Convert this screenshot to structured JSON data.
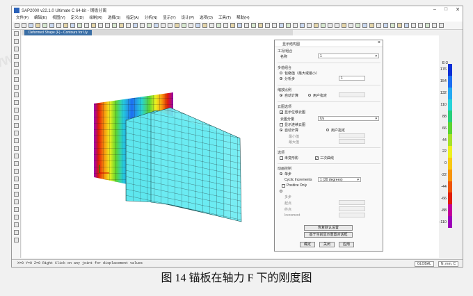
{
  "window": {
    "title": "SAP2000 v22.1.0 Ultimate C 64-bit - 钢板分离",
    "controls": [
      "–",
      "□",
      "✕"
    ]
  },
  "menu": [
    "文件(F)",
    "编辑(E)",
    "视图(V)",
    "定义(D)",
    "绘制(R)",
    "选择(S)",
    "指定(A)",
    "分析(N)",
    "显示(Y)",
    "设计(P)",
    "选项(O)",
    "工具(T)",
    "帮助(H)"
  ],
  "view_tab": "Deformed Shape (F) - Contours for Uy",
  "status": {
    "text": "X=0 Y=0 Z=0  Right Click on any joint for displacement values",
    "coord": "GLOBAL",
    "units": "N, mm, C"
  },
  "legend": {
    "header": "E-3",
    "labels": [
      "176",
      "154",
      "132",
      "110",
      "88",
      "66",
      "44",
      "22",
      "0",
      "-22",
      "-44",
      "-66",
      "-88",
      "-110"
    ],
    "colors": [
      "#0b2fd6",
      "#1d6ef2",
      "#25a9f2",
      "#27d3d8",
      "#27cf7a",
      "#5bd431",
      "#a6e12a",
      "#ecf01f",
      "#f8c813",
      "#f7940d",
      "#ee5408",
      "#e11d07",
      "#c2009b",
      "#9d00b9"
    ]
  },
  "dialog": {
    "title": "显示结构图",
    "case_section": "工况/组合",
    "name_label": "名称",
    "name_value": "1",
    "multi_section": "多值组合",
    "env_max": "包络值（最大或最小）",
    "step_label": "分析步",
    "step_value": "1",
    "scale_section": "缩放比例",
    "auto": "自动计算",
    "user": "用户指定",
    "contour_section": "云图选项",
    "show_contour": "显示位移云图",
    "contour_component_label": "云图分量",
    "contour_component_value": "Uy",
    "show_undeformed": "显示连续云图",
    "contour_auto": "自动计算",
    "contour_user": "用户指定",
    "min_label": "最小值",
    "max_label": "最大值",
    "options_section": "选项",
    "wire_shadow": "未变形影",
    "cubic_curve": "三次曲线",
    "anim_section": "动画控制",
    "step_anim": "单步",
    "cyclic_label": "Cyclic Increments",
    "cyclic_value": "1 (30 degrees)",
    "positive_only": "Positive Only",
    "multi_step": "多步",
    "start_label": "起点",
    "end_label": "终点",
    "increment_label": "Increment",
    "reset_btn": "恢复默认设置",
    "save_btn": "基于当前显示重置对话框",
    "ok_btn": "确定",
    "close_btn": "关闭",
    "apply_btn": "应用"
  },
  "caption": "图 14 锚板在轴力 F 下的刚度图",
  "watermark": "www.alwindoor.com"
}
